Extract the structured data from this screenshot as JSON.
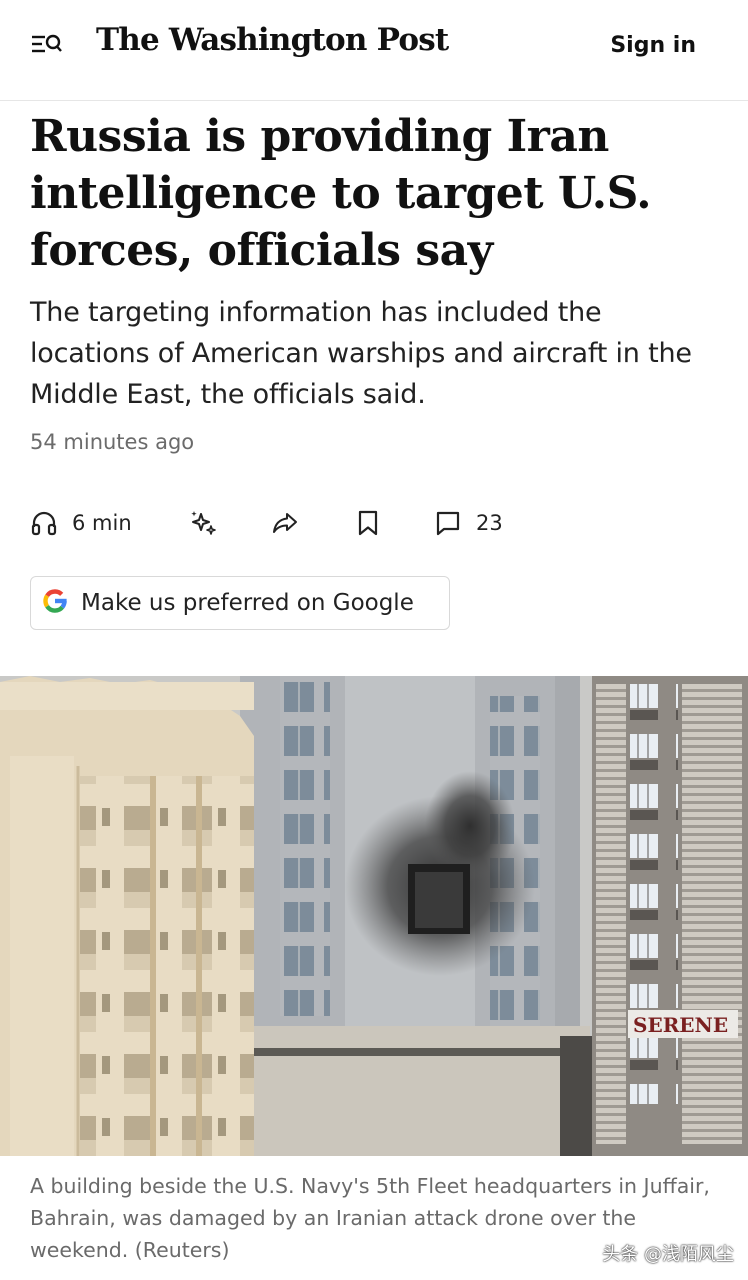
{
  "header": {
    "logo": "The Washington Post",
    "signin_label": "Sign in",
    "menu_icon": "menu-search-icon"
  },
  "article": {
    "headline": "Russia is providing Iran intelligence to target U.S. forces, officials say",
    "dek": "The targeting information has included the locations of American warships and aircraft in the Middle East, the officials said.",
    "timestamp": "54 minutes ago"
  },
  "toolbar": {
    "listen_label": "6 min",
    "listen_icon": "headphones-icon",
    "ai_icon": "sparkles-icon",
    "share_icon": "share-icon",
    "save_icon": "bookmark-icon",
    "comments_icon": "comment-icon",
    "comments_count": "23"
  },
  "google_button": {
    "label": "Make us preferred on Google",
    "icon": "google-g-icon"
  },
  "photo": {
    "sign_text": "SERENE"
  },
  "caption": "A building beside the U.S. Navy's 5th Fleet headquarters in Juffair, Bahrain, was damaged by an Iranian attack drone over the weekend. (Reuters)",
  "watermark": "头条 @浅陌风尘",
  "colors": {
    "text": "#111111",
    "meta": "#6b6b6b",
    "google_blue": "#4285F4",
    "google_red": "#EA4335",
    "google_yellow": "#FBBC05",
    "google_green": "#34A853"
  }
}
